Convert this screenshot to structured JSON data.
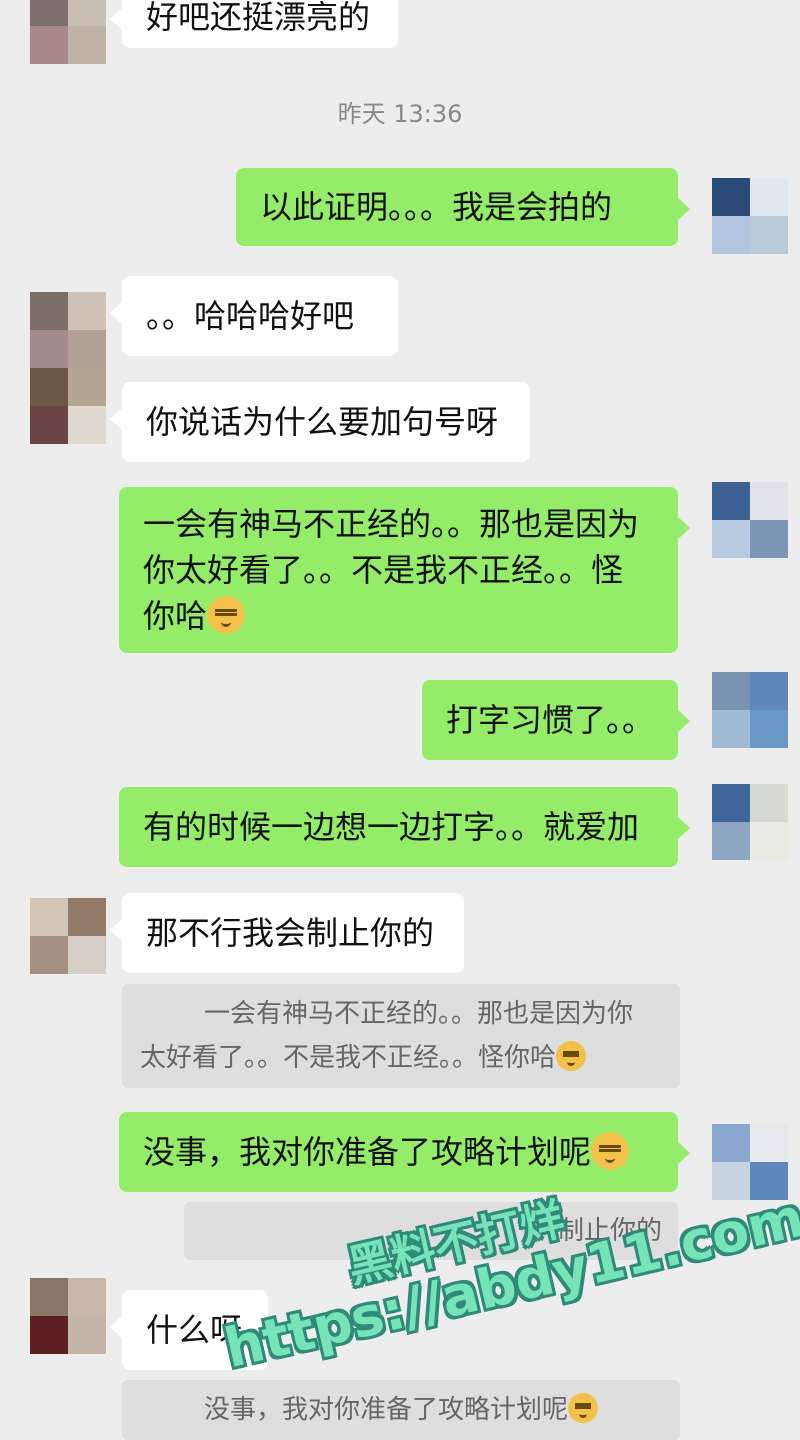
{
  "colors": {
    "background": "#ededed",
    "bubble_sent": "#95ec69",
    "bubble_received": "#ffffff",
    "quote_bg": "#dedede"
  },
  "timestamp": "昨天 13:36",
  "messages": [
    {
      "side": "received",
      "text": "好吧还挺漂亮的"
    },
    {
      "side": "sent",
      "text": "以此证明。。。我是会拍的"
    },
    {
      "side": "received",
      "text": "。。哈哈哈好吧"
    },
    {
      "side": "received",
      "text": "你说话为什么要加句号呀"
    },
    {
      "side": "sent",
      "line1": "一会有神马不正经的。。那也是因为",
      "line2": "你太好看了。。不是我不正经。。怪",
      "line3": "你哈",
      "emoji": "doge-emoji"
    },
    {
      "side": "sent",
      "text": "打字习惯了。。"
    },
    {
      "side": "sent",
      "text": "有的时候一边想一边打字。。就爱加"
    },
    {
      "side": "received",
      "text": "那不行我会制止你的"
    },
    {
      "side": "quote",
      "line1": "一会有神马不正经的。。那也是因为你",
      "line2": "太好看了。。不是我不正经。。怪你哈",
      "emoji": "doge-emoji"
    },
    {
      "side": "sent",
      "text": "没事，我对你准备了攻略计划呢",
      "emoji": "doge-emoji"
    },
    {
      "side": "quote",
      "text": "制止你的"
    },
    {
      "side": "received",
      "text": "什么呀"
    },
    {
      "side": "quote",
      "text": "没事，我对你准备了攻略计划呢",
      "emoji": "doge-emoji"
    }
  ],
  "watermark": {
    "line1": "黑料不打烊",
    "line2": "https://abdy11.com"
  }
}
